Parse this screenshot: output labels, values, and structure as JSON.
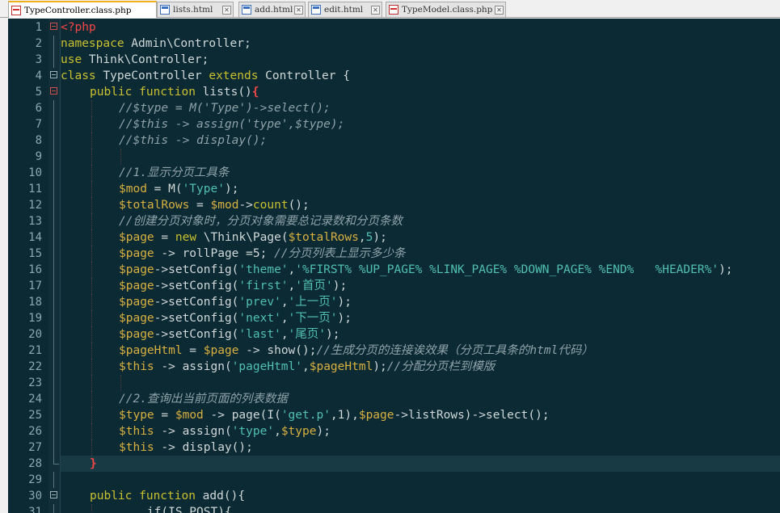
{
  "tabs": [
    {
      "label": "TypeController.class.php",
      "icon": "php-file-icon",
      "active": true
    },
    {
      "label": "lists.html",
      "icon": "html-file-icon",
      "active": false
    },
    {
      "label": "add.html",
      "icon": "html-file-icon",
      "active": false
    },
    {
      "label": "edit.html",
      "icon": "html-file-icon",
      "active": false
    },
    {
      "label": "TypeModel.class.php",
      "icon": "php-file-icon",
      "active": false
    }
  ],
  "close_glyph": "✕",
  "colors": {
    "editor_background": "#0c2a34",
    "keyword": "#c8c030",
    "variable": "#d8b040",
    "string": "#50c0b0",
    "comment": "#8fa2a8",
    "php_tag": "#f44747"
  },
  "current_line": 28,
  "lines": [
    {
      "n": "1",
      "indent": 0,
      "fold": "open-red",
      "tokens": [
        [
          "tag",
          "<?php"
        ]
      ]
    },
    {
      "n": "2",
      "indent": 0,
      "tokens": [
        [
          "kw",
          "namespace"
        ],
        [
          "fn",
          " Admin\\Controller;"
        ]
      ]
    },
    {
      "n": "3",
      "indent": 0,
      "tokens": [
        [
          "kw",
          "use"
        ],
        [
          "fn",
          " Think\\Controller;"
        ]
      ]
    },
    {
      "n": "4",
      "indent": 0,
      "fold": "open",
      "tokens": [
        [
          "kw",
          "class"
        ],
        [
          "fn",
          " TypeController "
        ],
        [
          "kw",
          "extends"
        ],
        [
          "fn",
          " Controller {"
        ]
      ]
    },
    {
      "n": "5",
      "indent": 1,
      "fold": "open-red",
      "tokens": [
        [
          "kw",
          "public function"
        ],
        [
          "fn",
          " lists()"
        ],
        [
          "br",
          "{"
        ]
      ]
    },
    {
      "n": "6",
      "indent": 2,
      "tokens": [
        [
          "com",
          "//$type = M('Type')->select();"
        ]
      ]
    },
    {
      "n": "7",
      "indent": 2,
      "tokens": [
        [
          "com",
          "//$this -> assign('type',$type);"
        ]
      ]
    },
    {
      "n": "8",
      "indent": 2,
      "tokens": [
        [
          "com",
          "//$this -> display();"
        ]
      ]
    },
    {
      "n": "9",
      "indent": 2,
      "tokens": []
    },
    {
      "n": "10",
      "indent": 2,
      "tokens": [
        [
          "com",
          "//1.显示分页工具条"
        ]
      ]
    },
    {
      "n": "11",
      "indent": 2,
      "tokens": [
        [
          "var",
          "$mod"
        ],
        [
          "fn",
          " = M("
        ],
        [
          "str",
          "'Type'"
        ],
        [
          "fn",
          ");"
        ]
      ]
    },
    {
      "n": "12",
      "indent": 2,
      "tokens": [
        [
          "var",
          "$totalRows"
        ],
        [
          "fn",
          " = "
        ],
        [
          "var",
          "$mod"
        ],
        [
          "fn",
          "->"
        ],
        [
          "kw",
          "count"
        ],
        [
          "fn",
          "();"
        ]
      ]
    },
    {
      "n": "13",
      "indent": 2,
      "tokens": [
        [
          "com",
          "//创建分页对象时，分页对象需要总记录数和分页条数"
        ]
      ]
    },
    {
      "n": "14",
      "indent": 2,
      "tokens": [
        [
          "var",
          "$page"
        ],
        [
          "fn",
          " = "
        ],
        [
          "kw",
          "new"
        ],
        [
          "fn",
          " \\Think\\Page("
        ],
        [
          "var",
          "$totalRows"
        ],
        [
          "fn",
          ","
        ],
        [
          "str",
          "5"
        ],
        [
          "fn",
          ");"
        ]
      ]
    },
    {
      "n": "15",
      "indent": 2,
      "tokens": [
        [
          "var",
          "$page"
        ],
        [
          "fn",
          " -> rollPage =5; "
        ],
        [
          "com",
          "//分页列表上显示多少条"
        ]
      ]
    },
    {
      "n": "16",
      "indent": 2,
      "tokens": [
        [
          "var",
          "$page"
        ],
        [
          "fn",
          "->setConfig("
        ],
        [
          "str",
          "'theme'"
        ],
        [
          "fn",
          ","
        ],
        [
          "str",
          "'%FIRST% %UP_PAGE% %LINK_PAGE% %DOWN_PAGE% %END%   %HEADER%'"
        ],
        [
          "fn",
          ");"
        ]
      ]
    },
    {
      "n": "17",
      "indent": 2,
      "tokens": [
        [
          "var",
          "$page"
        ],
        [
          "fn",
          "->setConfig("
        ],
        [
          "str",
          "'first'"
        ],
        [
          "fn",
          ","
        ],
        [
          "str",
          "'首页'"
        ],
        [
          "fn",
          ");"
        ]
      ]
    },
    {
      "n": "18",
      "indent": 2,
      "tokens": [
        [
          "var",
          "$page"
        ],
        [
          "fn",
          "->setConfig("
        ],
        [
          "str",
          "'prev'"
        ],
        [
          "fn",
          ","
        ],
        [
          "str",
          "'上一页'"
        ],
        [
          "fn",
          ");"
        ]
      ]
    },
    {
      "n": "19",
      "indent": 2,
      "tokens": [
        [
          "var",
          "$page"
        ],
        [
          "fn",
          "->setConfig("
        ],
        [
          "str",
          "'next'"
        ],
        [
          "fn",
          ","
        ],
        [
          "str",
          "'下一页'"
        ],
        [
          "fn",
          ");"
        ]
      ]
    },
    {
      "n": "20",
      "indent": 2,
      "tokens": [
        [
          "var",
          "$page"
        ],
        [
          "fn",
          "->setConfig("
        ],
        [
          "str",
          "'last'"
        ],
        [
          "fn",
          ","
        ],
        [
          "str",
          "'尾页'"
        ],
        [
          "fn",
          ");"
        ]
      ]
    },
    {
      "n": "21",
      "indent": 2,
      "tokens": [
        [
          "var",
          "$pageHtml"
        ],
        [
          "fn",
          " = "
        ],
        [
          "var",
          "$page"
        ],
        [
          "fn",
          " -> show();"
        ],
        [
          "com",
          "//生成分页的连接诶效果（分页工具条的html代码）"
        ]
      ]
    },
    {
      "n": "22",
      "indent": 2,
      "tokens": [
        [
          "var",
          "$this"
        ],
        [
          "fn",
          " -> assign("
        ],
        [
          "str",
          "'pageHtml'"
        ],
        [
          "fn",
          ","
        ],
        [
          "var",
          "$pageHtml"
        ],
        [
          "fn",
          ");"
        ],
        [
          "com",
          "//分配分页栏到模版"
        ]
      ]
    },
    {
      "n": "23",
      "indent": 2,
      "tokens": []
    },
    {
      "n": "24",
      "indent": 2,
      "tokens": [
        [
          "com",
          "//2.查询出当前页面的列表数据"
        ]
      ]
    },
    {
      "n": "25",
      "indent": 2,
      "tokens": [
        [
          "var",
          "$type"
        ],
        [
          "fn",
          " = "
        ],
        [
          "var",
          "$mod"
        ],
        [
          "fn",
          " -> page(I("
        ],
        [
          "str",
          "'get.p'"
        ],
        [
          "fn",
          ",1),"
        ],
        [
          "var",
          "$page"
        ],
        [
          "fn",
          "->listRows)->select();"
        ]
      ]
    },
    {
      "n": "26",
      "indent": 2,
      "tokens": [
        [
          "var",
          "$this"
        ],
        [
          "fn",
          " -> assign("
        ],
        [
          "str",
          "'type'"
        ],
        [
          "fn",
          ","
        ],
        [
          "var",
          "$type"
        ],
        [
          "fn",
          ");"
        ]
      ]
    },
    {
      "n": "27",
      "indent": 2,
      "tokens": [
        [
          "var",
          "$this"
        ],
        [
          "fn",
          " -> display();"
        ]
      ]
    },
    {
      "n": "28",
      "indent": 1,
      "fold": "end",
      "tokens": [
        [
          "br",
          "}"
        ]
      ]
    },
    {
      "n": "29",
      "indent": 1,
      "tokens": []
    },
    {
      "n": "30",
      "indent": 1,
      "fold": "open",
      "tokens": [
        [
          "kw",
          "public function"
        ],
        [
          "fn",
          " add(){"
        ]
      ]
    },
    {
      "n": "31",
      "indent": 2,
      "tokens": [
        [
          "fn",
          "    if(IS_POST){"
        ]
      ]
    }
  ]
}
